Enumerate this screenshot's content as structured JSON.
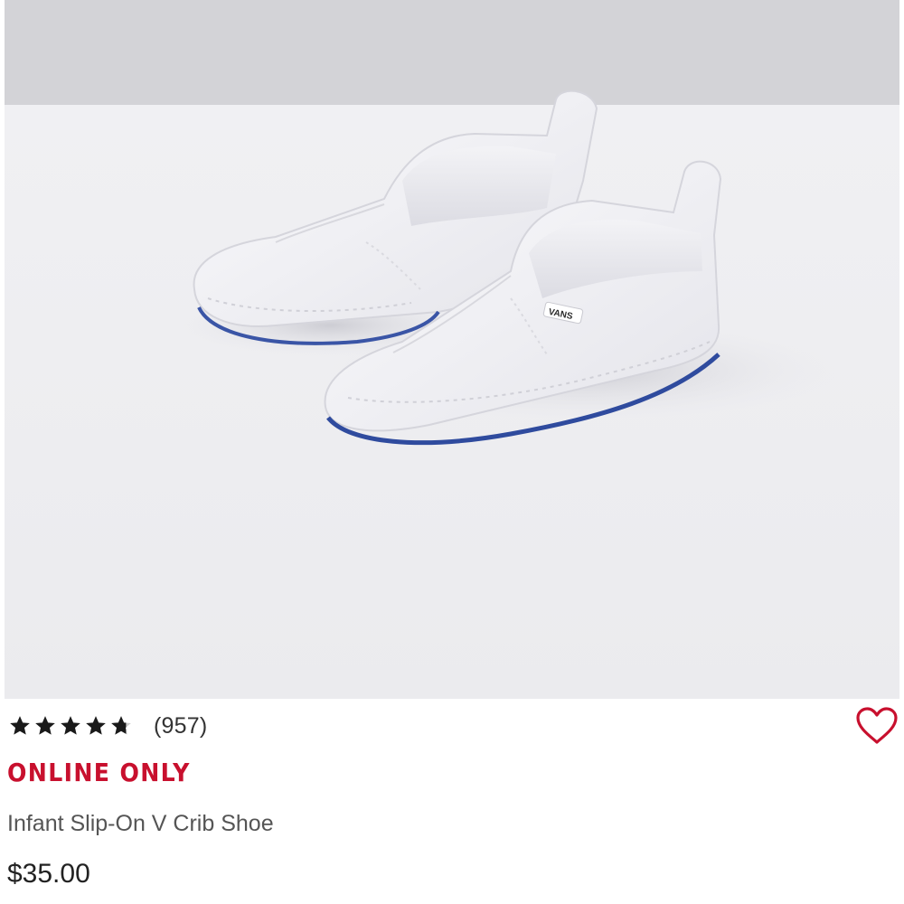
{
  "product": {
    "image": {
      "subject": "shoe-image",
      "logo_text": "VANS"
    },
    "rating": {
      "stars": 4.6,
      "max": 5,
      "review_count": "(957)"
    },
    "badge": "ONLINE ONLY",
    "name": "Infant Slip-On V Crib Shoe",
    "price": "$35.00",
    "favorite_icon": "heart-outline-icon"
  },
  "colors": {
    "badge": "#c8102e",
    "favorite": "#c8102e",
    "stars": "#1a1a1a"
  }
}
